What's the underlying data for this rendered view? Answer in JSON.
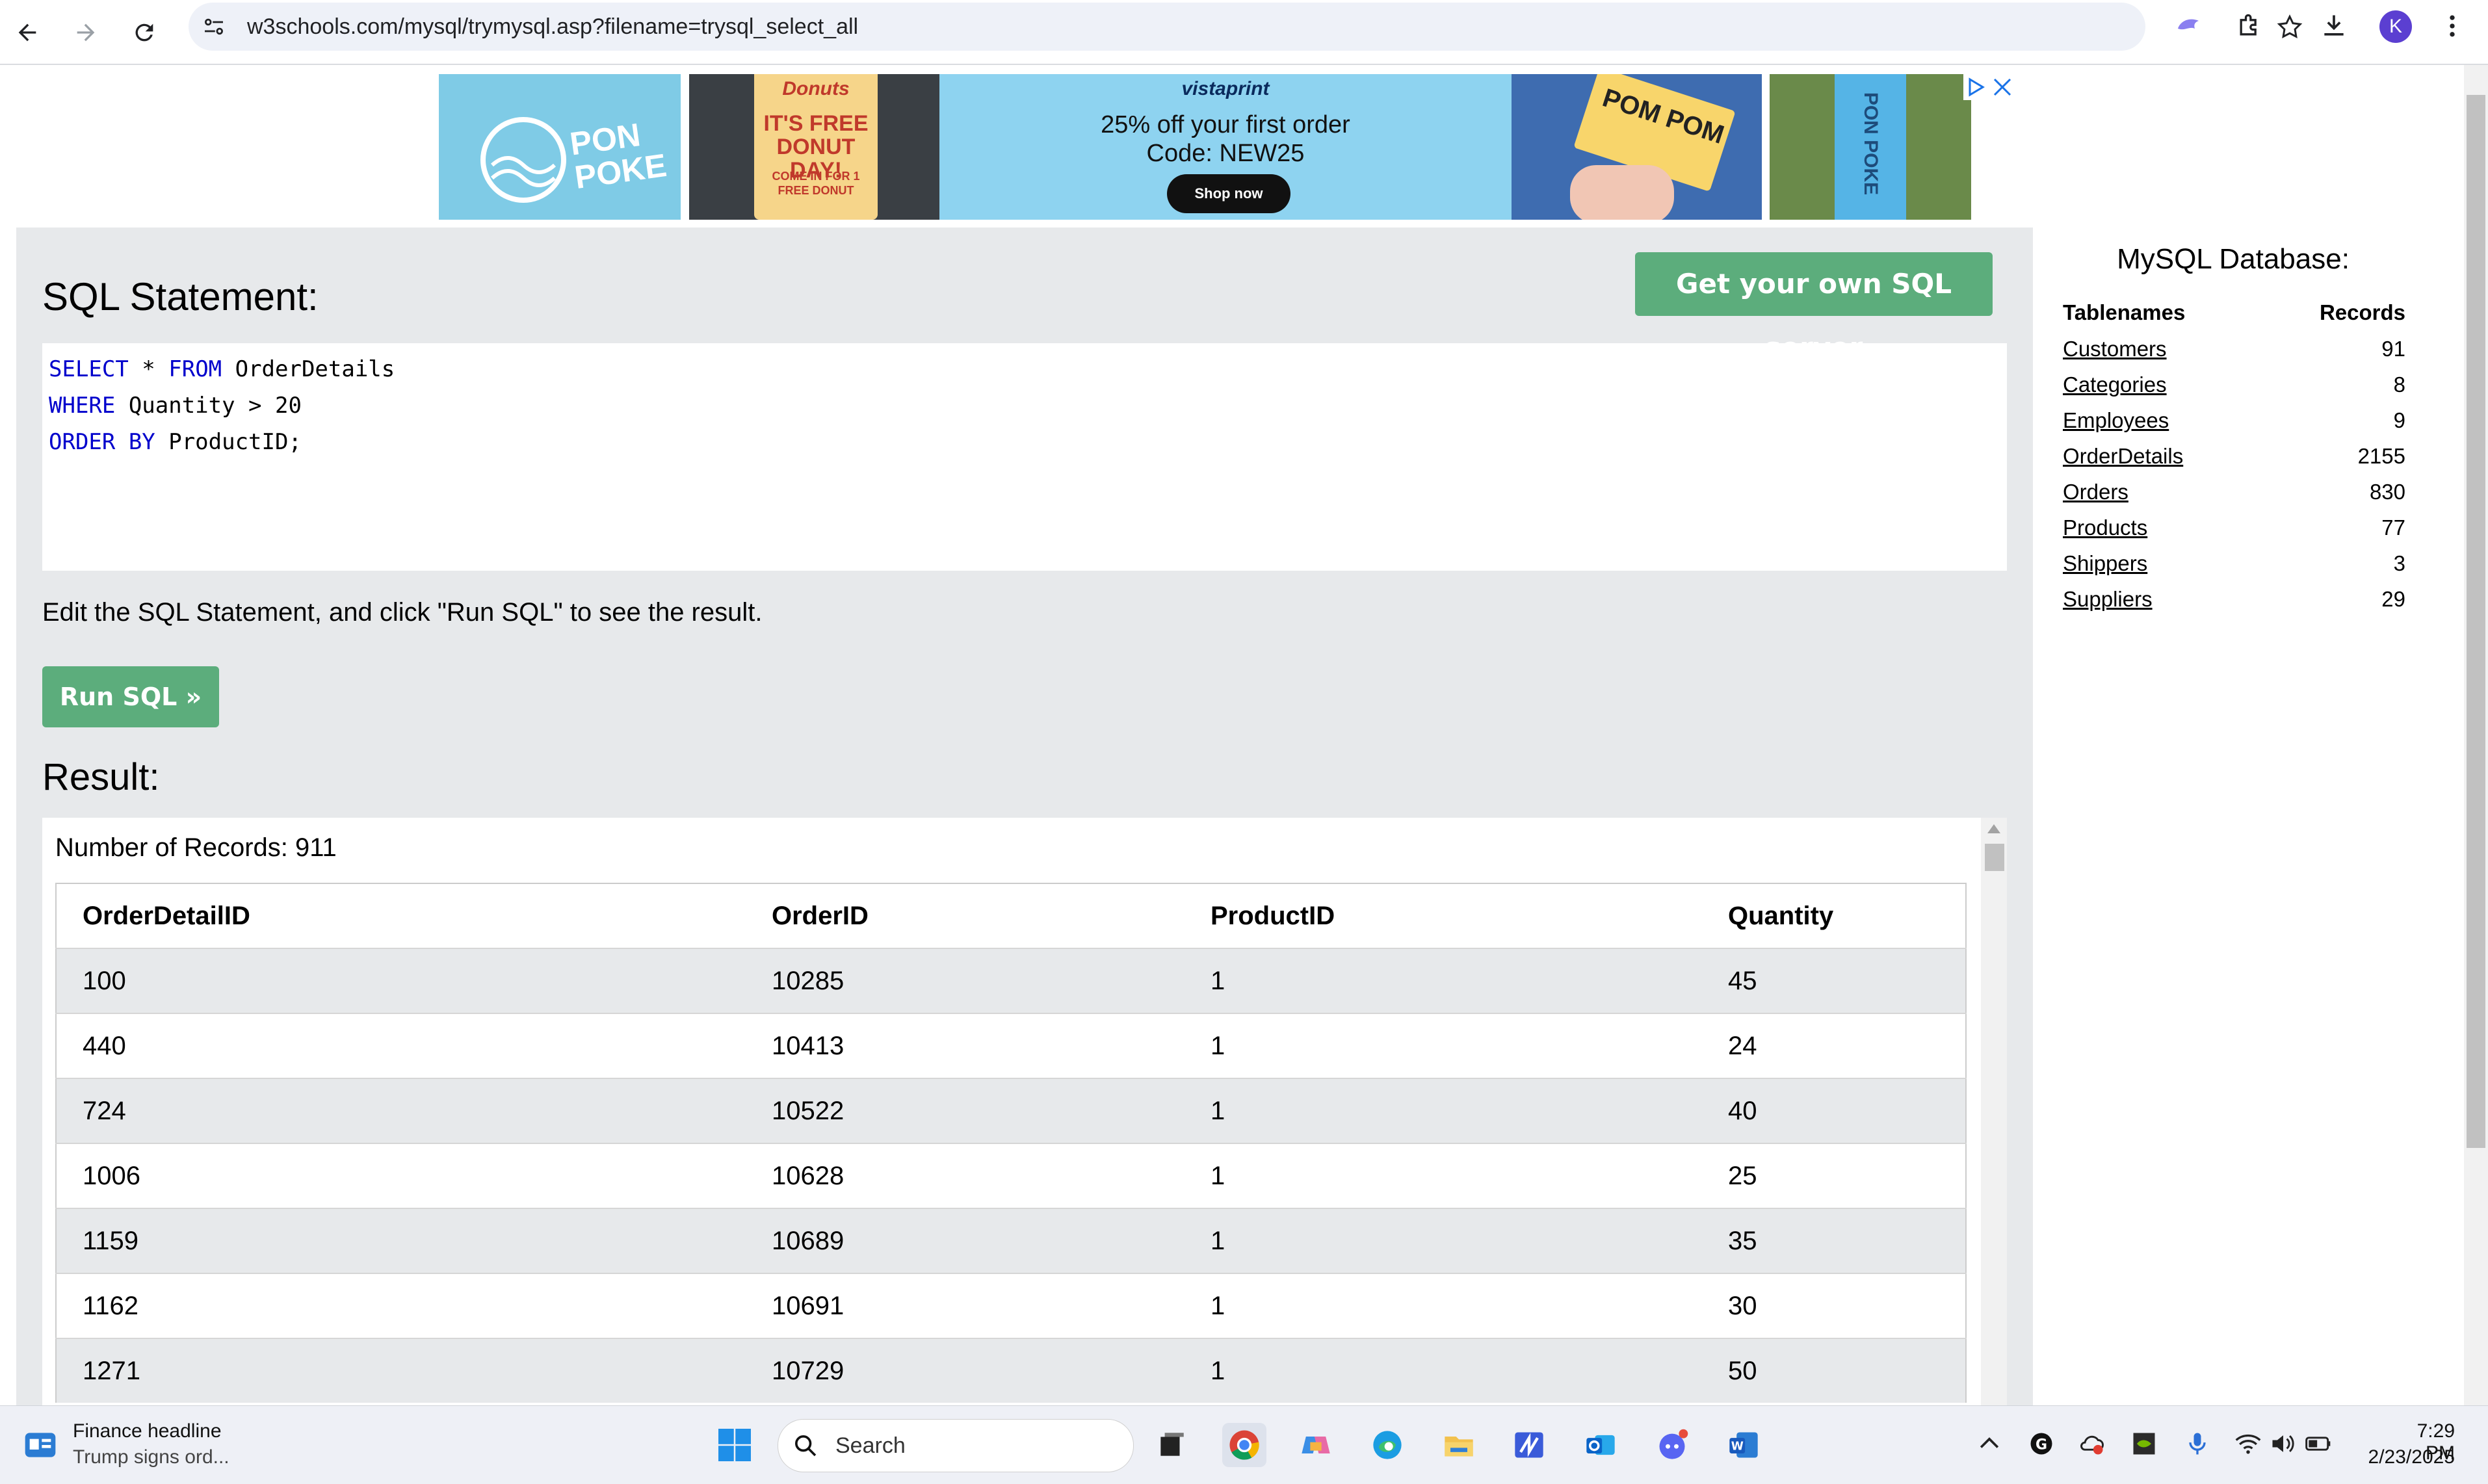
{
  "browser": {
    "url": "w3schools.com/mysql/trymysql.asp?filename=trysql_select_all",
    "avatar_letter": "K"
  },
  "ad": {
    "brand": "vistaprint",
    "headline_line1": "25% off your first order",
    "headline_line2": "Code: NEW25",
    "cta": "Shop now",
    "tile1_text": "PON POKE",
    "tile2_text_top": "Donuts",
    "tile2_text_main": "IT'S FREE DONUT DAY!",
    "tile2_text_sub": "COME IN FOR 1 FREE DONUT",
    "tile3_text": "POM POM",
    "tile4_text": "PON POKE"
  },
  "editor": {
    "title": "SQL Statement:",
    "own_server_button": "Get your own SQL server",
    "lines": [
      {
        "kw1": "SELECT",
        "t1": " * ",
        "kw2": "FROM",
        "t2": " OrderDetails"
      },
      {
        "kw1": "WHERE",
        "t1": " Quantity > 20",
        "kw2": "",
        "t2": ""
      },
      {
        "kw1": "ORDER BY",
        "t1": " ProductID;",
        "kw2": "",
        "t2": ""
      }
    ],
    "hint": "Edit the SQL Statement, and click \"Run SQL\" to see the result.",
    "run_button": "Run SQL »"
  },
  "result": {
    "title": "Result:",
    "record_count": "Number of Records: 911",
    "columns": [
      "OrderDetailID",
      "OrderID",
      "ProductID",
      "Quantity"
    ],
    "rows": [
      [
        "100",
        "10285",
        "1",
        "45"
      ],
      [
        "440",
        "10413",
        "1",
        "24"
      ],
      [
        "724",
        "10522",
        "1",
        "40"
      ],
      [
        "1006",
        "10628",
        "1",
        "25"
      ],
      [
        "1159",
        "10689",
        "1",
        "35"
      ],
      [
        "1162",
        "10691",
        "1",
        "30"
      ],
      [
        "1271",
        "10729",
        "1",
        "50"
      ]
    ]
  },
  "sidebar": {
    "title": "MySQL Database:",
    "col_tablenames": "Tablenames",
    "col_records": "Records",
    "tables": [
      {
        "name": "Customers",
        "records": "91"
      },
      {
        "name": "Categories",
        "records": "8"
      },
      {
        "name": "Employees",
        "records": "9"
      },
      {
        "name": "OrderDetails",
        "records": "2155"
      },
      {
        "name": "Orders",
        "records": "830"
      },
      {
        "name": "Products",
        "records": "77"
      },
      {
        "name": "Shippers",
        "records": "3"
      },
      {
        "name": "Suppliers",
        "records": "29"
      }
    ]
  },
  "taskbar": {
    "news_title": "Finance headline",
    "news_sub": "Trump signs ord...",
    "search_placeholder": "Search",
    "time": "7:29 PM",
    "date": "2/23/2025"
  },
  "colors": {
    "w3_green": "#5cad7c",
    "panel_gray": "#e7e9eb",
    "sql_keyword": "#0000cc",
    "ad_blue": "#8ed3f0"
  }
}
